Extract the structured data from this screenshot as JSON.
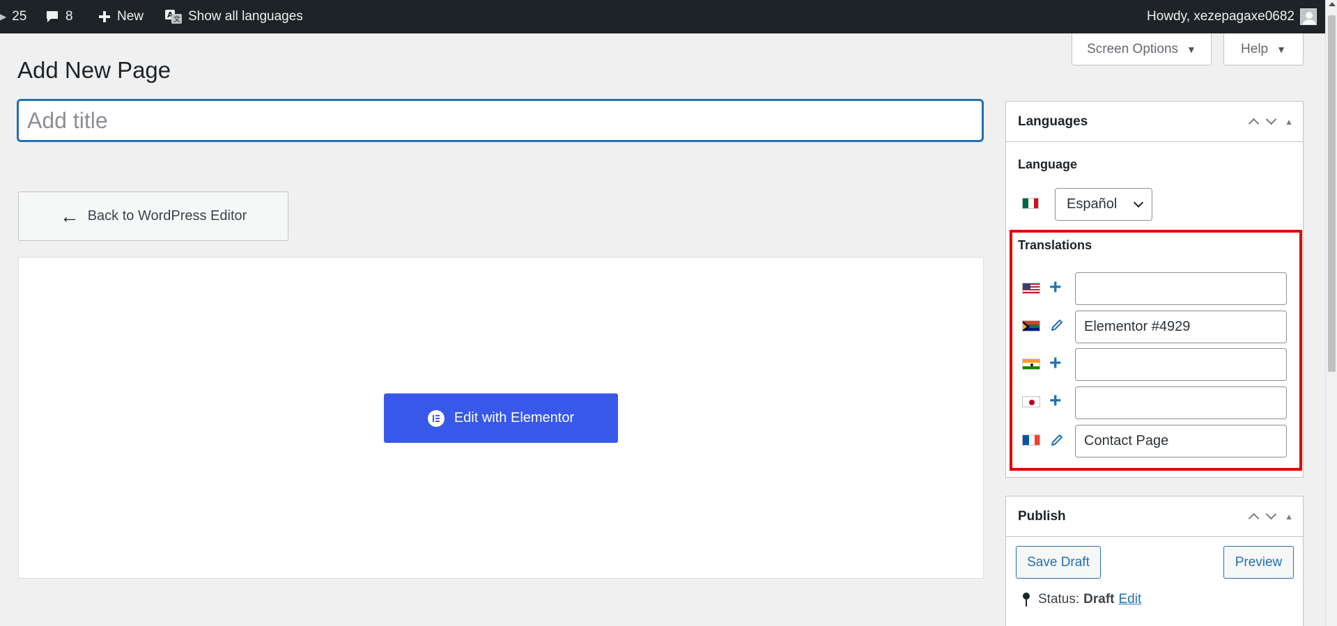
{
  "adminbar": {
    "updates_count": "25",
    "comments_count": "8",
    "new_label": "New",
    "languages_label": "Show all languages",
    "howdy_label": "Howdy, xezepagaxe0682"
  },
  "screen_options_label": "Screen Options",
  "help_label": "Help",
  "page_title": "Add New Page",
  "title_input": {
    "placeholder": "Add title",
    "value": ""
  },
  "back_button_label": "Back to WordPress Editor",
  "elementor_button_label": "Edit with Elementor",
  "languages_box": {
    "title": "Languages",
    "language_label": "Language",
    "selected_language": "Español",
    "selected_flag": "mexico-flag",
    "translations_label": "Translations",
    "translations": [
      {
        "flag": "usa-flag",
        "action": "add",
        "value": ""
      },
      {
        "flag": "south-africa-flag",
        "action": "edit",
        "value": "Elementor #4929"
      },
      {
        "flag": "india-flag",
        "action": "add",
        "value": ""
      },
      {
        "flag": "japan-flag",
        "action": "add",
        "value": ""
      },
      {
        "flag": "france-flag",
        "action": "edit",
        "value": "Contact Page"
      }
    ]
  },
  "publish_box": {
    "title": "Publish",
    "save_draft_label": "Save Draft",
    "preview_label": "Preview",
    "status_prefix": "Status:",
    "status_value": "Draft",
    "status_edit_label": "Edit"
  },
  "colors": {
    "adminbar_bg": "#1d2327",
    "link_blue": "#2271b1",
    "elementor_blue": "#3858e9",
    "highlight_red": "#e00000"
  }
}
